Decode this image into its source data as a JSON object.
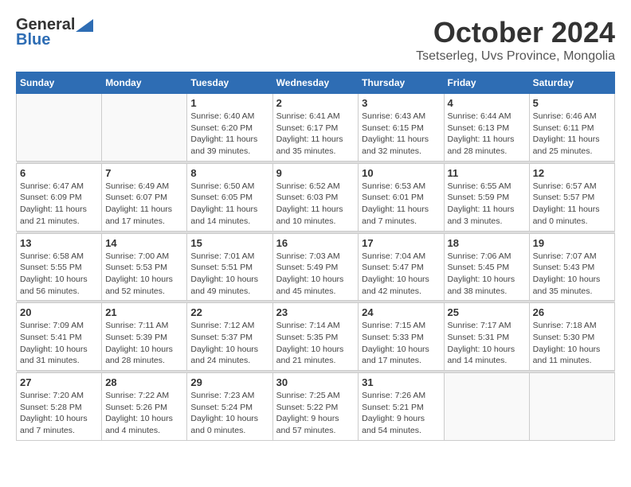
{
  "logo": {
    "general": "General",
    "blue": "Blue"
  },
  "header": {
    "month": "October 2024",
    "location": "Tsetserleg, Uvs Province, Mongolia"
  },
  "weekdays": [
    "Sunday",
    "Monday",
    "Tuesday",
    "Wednesday",
    "Thursday",
    "Friday",
    "Saturday"
  ],
  "weeks": [
    [
      {
        "day": "",
        "info": ""
      },
      {
        "day": "",
        "info": ""
      },
      {
        "day": "1",
        "info": "Sunrise: 6:40 AM\nSunset: 6:20 PM\nDaylight: 11 hours and 39 minutes."
      },
      {
        "day": "2",
        "info": "Sunrise: 6:41 AM\nSunset: 6:17 PM\nDaylight: 11 hours and 35 minutes."
      },
      {
        "day": "3",
        "info": "Sunrise: 6:43 AM\nSunset: 6:15 PM\nDaylight: 11 hours and 32 minutes."
      },
      {
        "day": "4",
        "info": "Sunrise: 6:44 AM\nSunset: 6:13 PM\nDaylight: 11 hours and 28 minutes."
      },
      {
        "day": "5",
        "info": "Sunrise: 6:46 AM\nSunset: 6:11 PM\nDaylight: 11 hours and 25 minutes."
      }
    ],
    [
      {
        "day": "6",
        "info": "Sunrise: 6:47 AM\nSunset: 6:09 PM\nDaylight: 11 hours and 21 minutes."
      },
      {
        "day": "7",
        "info": "Sunrise: 6:49 AM\nSunset: 6:07 PM\nDaylight: 11 hours and 17 minutes."
      },
      {
        "day": "8",
        "info": "Sunrise: 6:50 AM\nSunset: 6:05 PM\nDaylight: 11 hours and 14 minutes."
      },
      {
        "day": "9",
        "info": "Sunrise: 6:52 AM\nSunset: 6:03 PM\nDaylight: 11 hours and 10 minutes."
      },
      {
        "day": "10",
        "info": "Sunrise: 6:53 AM\nSunset: 6:01 PM\nDaylight: 11 hours and 7 minutes."
      },
      {
        "day": "11",
        "info": "Sunrise: 6:55 AM\nSunset: 5:59 PM\nDaylight: 11 hours and 3 minutes."
      },
      {
        "day": "12",
        "info": "Sunrise: 6:57 AM\nSunset: 5:57 PM\nDaylight: 11 hours and 0 minutes."
      }
    ],
    [
      {
        "day": "13",
        "info": "Sunrise: 6:58 AM\nSunset: 5:55 PM\nDaylight: 10 hours and 56 minutes."
      },
      {
        "day": "14",
        "info": "Sunrise: 7:00 AM\nSunset: 5:53 PM\nDaylight: 10 hours and 52 minutes."
      },
      {
        "day": "15",
        "info": "Sunrise: 7:01 AM\nSunset: 5:51 PM\nDaylight: 10 hours and 49 minutes."
      },
      {
        "day": "16",
        "info": "Sunrise: 7:03 AM\nSunset: 5:49 PM\nDaylight: 10 hours and 45 minutes."
      },
      {
        "day": "17",
        "info": "Sunrise: 7:04 AM\nSunset: 5:47 PM\nDaylight: 10 hours and 42 minutes."
      },
      {
        "day": "18",
        "info": "Sunrise: 7:06 AM\nSunset: 5:45 PM\nDaylight: 10 hours and 38 minutes."
      },
      {
        "day": "19",
        "info": "Sunrise: 7:07 AM\nSunset: 5:43 PM\nDaylight: 10 hours and 35 minutes."
      }
    ],
    [
      {
        "day": "20",
        "info": "Sunrise: 7:09 AM\nSunset: 5:41 PM\nDaylight: 10 hours and 31 minutes."
      },
      {
        "day": "21",
        "info": "Sunrise: 7:11 AM\nSunset: 5:39 PM\nDaylight: 10 hours and 28 minutes."
      },
      {
        "day": "22",
        "info": "Sunrise: 7:12 AM\nSunset: 5:37 PM\nDaylight: 10 hours and 24 minutes."
      },
      {
        "day": "23",
        "info": "Sunrise: 7:14 AM\nSunset: 5:35 PM\nDaylight: 10 hours and 21 minutes."
      },
      {
        "day": "24",
        "info": "Sunrise: 7:15 AM\nSunset: 5:33 PM\nDaylight: 10 hours and 17 minutes."
      },
      {
        "day": "25",
        "info": "Sunrise: 7:17 AM\nSunset: 5:31 PM\nDaylight: 10 hours and 14 minutes."
      },
      {
        "day": "26",
        "info": "Sunrise: 7:18 AM\nSunset: 5:30 PM\nDaylight: 10 hours and 11 minutes."
      }
    ],
    [
      {
        "day": "27",
        "info": "Sunrise: 7:20 AM\nSunset: 5:28 PM\nDaylight: 10 hours and 7 minutes."
      },
      {
        "day": "28",
        "info": "Sunrise: 7:22 AM\nSunset: 5:26 PM\nDaylight: 10 hours and 4 minutes."
      },
      {
        "day": "29",
        "info": "Sunrise: 7:23 AM\nSunset: 5:24 PM\nDaylight: 10 hours and 0 minutes."
      },
      {
        "day": "30",
        "info": "Sunrise: 7:25 AM\nSunset: 5:22 PM\nDaylight: 9 hours and 57 minutes."
      },
      {
        "day": "31",
        "info": "Sunrise: 7:26 AM\nSunset: 5:21 PM\nDaylight: 9 hours and 54 minutes."
      },
      {
        "day": "",
        "info": ""
      },
      {
        "day": "",
        "info": ""
      }
    ]
  ]
}
